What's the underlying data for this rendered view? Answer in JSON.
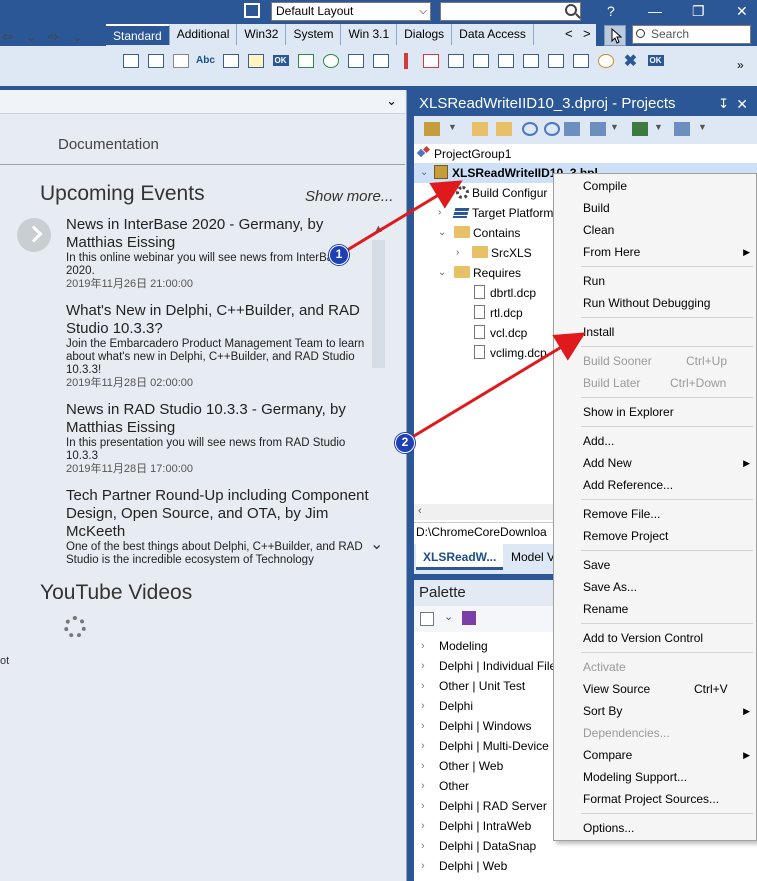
{
  "toolbar": {
    "layout_select": "Default Layout",
    "help_glyph": "?",
    "minimize_glyph": "—",
    "restore_glyph": "❐",
    "close_glyph": "✕",
    "palette_tabs": [
      "Standard",
      "Additional",
      "Win32",
      "System",
      "Win 3.1",
      "Dialogs",
      "Data Access"
    ],
    "active_palette_tab": "Standard",
    "palette_search_placeholder": "Search",
    "tabs_prev": "<",
    "tabs_next": ">",
    "component_abc": "Abc",
    "component_ok": "OK",
    "more": "»"
  },
  "welcome": {
    "documentation": "Documentation",
    "upcoming_events": "Upcoming Events",
    "show_more": "Show more...",
    "youtube_videos": "YouTube Videos",
    "news": [
      {
        "title": "News in InterBase 2020 - Germany, by Matthias Eissing",
        "desc": "In this online webinar you will see news from InterBase 2020.",
        "date": "2019年11月26日 21:00:00"
      },
      {
        "title": "What's New in Delphi, C++Builder, and RAD Studio 10.3.3?",
        "desc": "Join the Embarcadero Product Management Team to learn about what's new in Delphi, C++Builder, and RAD Studio 10.3.3!",
        "date": "2019年11月28日 02:00:00"
      },
      {
        "title": "News in RAD Studio 10.3.3 - Germany, by Matthias Eissing",
        "desc": "In this presentation you will see news from RAD Studio 10.3.3",
        "date": "2019年11月28日 17:00:00"
      },
      {
        "title": "Tech Partner Round-Up including Component Design, Open Source, and OTA, by Jim McKeeth",
        "desc": "One of the best things about Delphi, C++Builder, and RAD Studio is the incredible ecosystem of Technology",
        "date": ""
      }
    ],
    "edge_text": "ot"
  },
  "projects": {
    "title": "XLSReadWriteIID10_3.dproj - Projects",
    "pin": "📌",
    "close": "✕",
    "tree": {
      "project_group": "ProjectGroup1",
      "project": "XLSReadWriteIID10_3.bpl",
      "build_configurations": "Build Configur",
      "target_platforms": "Target Platform",
      "contains": "Contains",
      "srcxls": "SrcXLS",
      "requires": "Requires",
      "files": [
        "dbrtl.dcp",
        "rtl.dcp",
        "vcl.dcp",
        "vclimg.dcp"
      ]
    },
    "path": "D:\\ChromeCoreDownloa",
    "tabs": [
      "XLSReadW...",
      "Model V"
    ]
  },
  "palette": {
    "title": "Palette",
    "categories": [
      "Modeling",
      "Delphi | Individual File",
      "Other | Unit Test",
      "Delphi",
      "Delphi | Windows",
      "Delphi | Multi-Device",
      "Other | Web",
      "Other",
      "Delphi | RAD Server",
      "Delphi | IntraWeb",
      "Delphi | DataSnap",
      "Delphi | Web"
    ]
  },
  "context_menu": {
    "items": [
      {
        "label": "Compile",
        "shortcut": "",
        "submenu": false,
        "disabled": false
      },
      {
        "label": "Build",
        "shortcut": "",
        "submenu": false,
        "disabled": false
      },
      {
        "label": "Clean",
        "shortcut": "",
        "submenu": false,
        "disabled": false
      },
      {
        "label": "From Here",
        "shortcut": "",
        "submenu": true,
        "disabled": false
      },
      {
        "label": "Run",
        "shortcut": "",
        "submenu": false,
        "disabled": false
      },
      {
        "label": "Run Without Debugging",
        "shortcut": "",
        "submenu": false,
        "disabled": false
      },
      {
        "label": "Install",
        "shortcut": "",
        "submenu": false,
        "disabled": false
      },
      {
        "label": "Build Sooner",
        "shortcut": "Ctrl+Up",
        "submenu": false,
        "disabled": true
      },
      {
        "label": "Build Later",
        "shortcut": "Ctrl+Down",
        "submenu": false,
        "disabled": true
      },
      {
        "label": "Show in Explorer",
        "shortcut": "",
        "submenu": false,
        "disabled": false
      },
      {
        "label": "Add...",
        "shortcut": "",
        "submenu": false,
        "disabled": false
      },
      {
        "label": "Add New",
        "shortcut": "",
        "submenu": true,
        "disabled": false
      },
      {
        "label": "Add Reference...",
        "shortcut": "",
        "submenu": false,
        "disabled": false
      },
      {
        "label": "Remove File...",
        "shortcut": "",
        "submenu": false,
        "disabled": false
      },
      {
        "label": "Remove Project",
        "shortcut": "",
        "submenu": false,
        "disabled": false
      },
      {
        "label": "Save",
        "shortcut": "",
        "submenu": false,
        "disabled": false
      },
      {
        "label": "Save As...",
        "shortcut": "",
        "submenu": false,
        "disabled": false
      },
      {
        "label": "Rename",
        "shortcut": "",
        "submenu": false,
        "disabled": false
      },
      {
        "label": "Add to Version Control",
        "shortcut": "",
        "submenu": false,
        "disabled": false
      },
      {
        "label": "Activate",
        "shortcut": "",
        "submenu": false,
        "disabled": true
      },
      {
        "label": "View Source",
        "shortcut": "Ctrl+V",
        "submenu": false,
        "disabled": false
      },
      {
        "label": "Sort By",
        "shortcut": "",
        "submenu": true,
        "disabled": false
      },
      {
        "label": "Dependencies...",
        "shortcut": "",
        "submenu": false,
        "disabled": true
      },
      {
        "label": "Compare",
        "shortcut": "",
        "submenu": true,
        "disabled": false
      },
      {
        "label": "Modeling Support...",
        "shortcut": "",
        "submenu": false,
        "disabled": false
      },
      {
        "label": "Format Project Sources...",
        "shortcut": "",
        "submenu": false,
        "disabled": false
      },
      {
        "label": "Options...",
        "shortcut": "",
        "submenu": false,
        "disabled": false
      }
    ]
  },
  "annotations": {
    "badge_1": "1",
    "badge_2": "2",
    "arrow_color": "#e0191c",
    "badge_color": "#1e3fb5"
  },
  "colors": {
    "ide_blue": "#2b5797",
    "welcome_bg": "#e6ecf2",
    "menu_bg": "#f5f5f5",
    "disabled_text": "#9a9a9a"
  }
}
